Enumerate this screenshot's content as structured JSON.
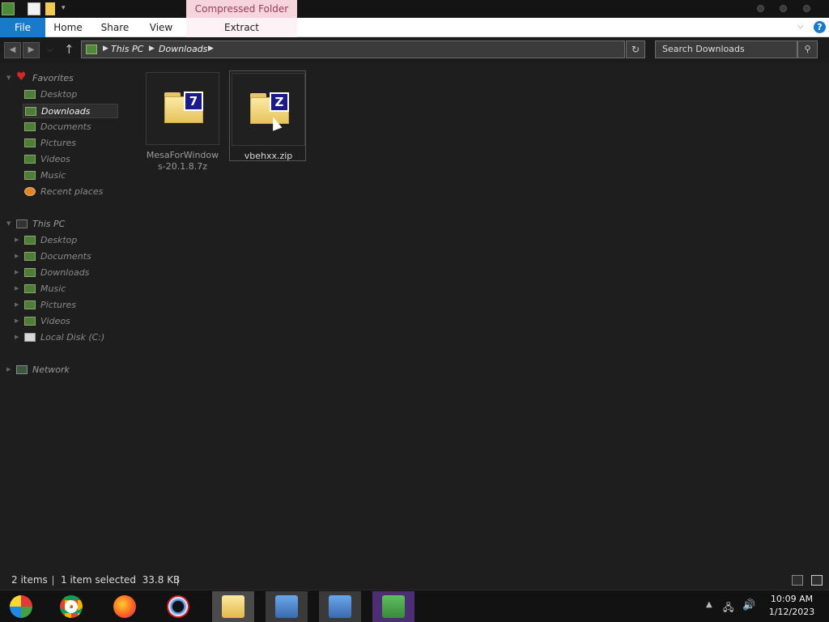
{
  "window": {
    "context_tab_label": "Compressed Folder Tools"
  },
  "ribbon": {
    "file_label": "File",
    "tabs": [
      "Home",
      "Share",
      "View"
    ],
    "extract_label": "Extract"
  },
  "address": {
    "crumbs": [
      "This PC",
      "Downloads"
    ],
    "search_placeholder": "Search Downloads"
  },
  "sidebar": {
    "favorites_label": "Favorites",
    "favorites": [
      "Desktop",
      "Downloads",
      "Documents",
      "Pictures",
      "Videos",
      "Music",
      "Recent places"
    ],
    "thispc_label": "This PC",
    "thispc": [
      "Desktop",
      "Documents",
      "Downloads",
      "Music",
      "Pictures",
      "Videos",
      "Local Disk (C:)"
    ],
    "network_label": "Network"
  },
  "files": [
    {
      "name": "MesaForWindows-20.1.8.7z",
      "badge": "7",
      "selected": false
    },
    {
      "name": "vbehxx.zip",
      "badge": "Z",
      "selected": true
    }
  ],
  "status": {
    "item_count": "2 items",
    "selection": "1 item selected  33.8 KB"
  },
  "taskbar": {
    "apps": [
      "start",
      "chrome",
      "firefox",
      "opera",
      "file-explorer",
      "network-setup",
      "network-setup-2",
      "users"
    ]
  },
  "clock": {
    "time": "10:09 AM",
    "date": "1/12/2023"
  }
}
